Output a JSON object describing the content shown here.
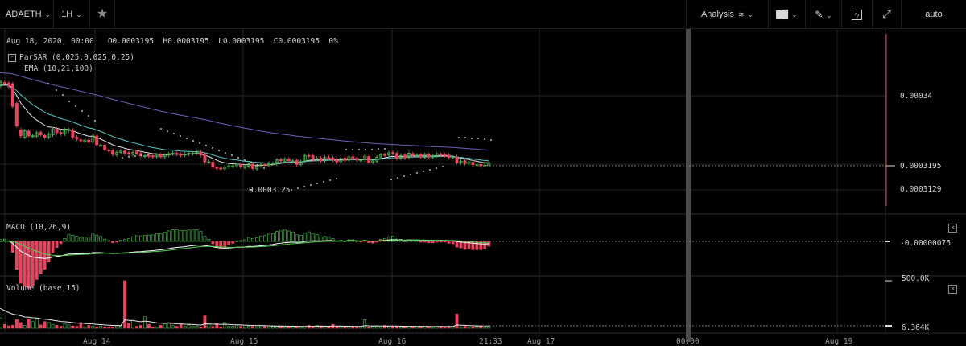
{
  "toolbar": {
    "symbol": "ADAETH",
    "interval": "1H",
    "analysis_label": "Analysis",
    "auto_label": "auto",
    "icons": [
      "star-icon",
      "indicators-icon",
      "bar-style-icon",
      "draw-pencil-icon",
      "chart-settings-icon",
      "fullscreen-icon"
    ]
  },
  "legend": {
    "ohlc": "Aug 18, 2020, 00:00   O0.0003195  H0.0003195  L0.0003195  C0.0003195  0%",
    "parsar": "ParSAR (0.025,0.025,0.25)",
    "ema": "EMA (10,21,100)",
    "macd": "MACD (10,26,9)",
    "volume": "Volume (base,15)"
  },
  "price_axis": {
    "labels": [
      {
        "text": "0.00034",
        "value": 0.00034
      },
      {
        "text": "0.0003195",
        "value": 0.0003195
      },
      {
        "text": "0.0003129",
        "value": 0.0003129
      }
    ],
    "low_annotation": "0.0003125"
  },
  "macd_axis": {
    "label": "-0.00000076"
  },
  "volume_axis": {
    "labels": [
      "500.0K",
      "6.364K"
    ]
  },
  "time_axis": {
    "labels": [
      "Aug 14",
      "Aug 15",
      "Aug 16",
      "21:33",
      "Aug 17",
      "00:00",
      "Aug 19"
    ]
  },
  "colors": {
    "bull": "#4caf50",
    "bear": "#e5455f",
    "ema_fast": "#e8e8e8",
    "ema_mid": "#5fc4c4",
    "ema_slow": "#6e5fb8",
    "macd": "#ffffff",
    "signal": "#55d055"
  },
  "chart_data": {
    "type": "candlestick",
    "price_open": [
      0.0003428,
      0.000343,
      0.000344,
      0.0003438,
      0.0003436,
      0.0003377,
      0.0003298,
      0.0003276,
      0.0003294,
      0.0003279,
      0.0003279,
      0.000329,
      0.0003281,
      0.0003275,
      0.0003283,
      0.00033,
      0.000329,
      0.0003286,
      0.0003296,
      0.0003297,
      0.0003276,
      0.0003268,
      0.0003263,
      0.0003267,
      0.0003262,
      0.0003279,
      0.0003252,
      0.0003252,
      0.0003237,
      0.0003236,
      0.0003223,
      0.000323,
      0.0003234,
      0.0003229,
      0.0003224,
      0.0003232,
      0.0003227,
      0.0003219,
      0.0003221,
      0.000322,
      0.0003217,
      0.0003223,
      0.0003217,
      0.0003222,
      0.0003226,
      0.0003227,
      0.0003224,
      0.0003222,
      0.0003225,
      0.0003227,
      0.0003228,
      0.0003232,
      0.0003222,
      0.0003202,
      0.0003201,
      0.0003185,
      0.0003183,
      0.0003181,
      0.0003186,
      0.0003189,
      0.000319,
      0.0003194,
      0.0003185,
      0.0003189,
      0.0003195,
      0.0003181,
      0.000319,
      0.0003194,
      0.0003192,
      0.0003197,
      0.0003196,
      0.0003208,
      0.0003204,
      0.000321,
      0.0003205,
      0.0003206,
      0.0003194,
      0.0003205,
      0.0003221,
      0.000322,
      0.000321,
      0.0003213,
      0.0003205,
      0.0003215,
      0.0003214,
      0.0003207,
      0.0003202,
      0.0003213,
      0.0003207,
      0.0003217,
      0.0003213,
      0.0003207,
      0.0003208,
      0.0003218,
      0.0003201,
      0.0003204,
      0.0003217,
      0.0003224,
      0.0003222,
      0.0003229,
      0.0003227,
      0.0003213,
      0.0003222,
      0.0003215,
      0.0003226,
      0.0003222,
      0.0003223,
      0.0003215,
      0.0003224,
      0.0003216,
      0.000322,
      0.0003225,
      0.0003223,
      0.0003222,
      0.0003215,
      0.0003217,
      0.00032,
      0.0003205,
      0.0003197,
      0.0003201,
      0.0003193,
      0.0003194,
      0.0003191,
      0.0003192,
      0.0003199,
      0.00032
    ],
    "price_close": [
      0.000343,
      0.0003441,
      0.0003437,
      0.0003428,
      0.0003368,
      0.000331,
      0.000328,
      0.0003295,
      0.000328,
      0.000328,
      0.0003289,
      0.0003283,
      0.0003275,
      0.0003285,
      0.0003301,
      0.000329,
      0.0003286,
      0.0003297,
      0.0003298,
      0.0003276,
      0.000327,
      0.0003265,
      0.0003267,
      0.0003261,
      0.000328,
      0.0003253,
      0.0003252,
      0.0003238,
      0.0003235,
      0.0003224,
      0.000323,
      0.0003234,
      0.0003228,
      0.0003225,
      0.000323,
      0.0003227,
      0.000322,
      0.000322,
      0.0003219,
      0.0003217,
      0.0003222,
      0.0003217,
      0.0003222,
      0.0003226,
      0.0003228,
      0.0003225,
      0.0003221,
      0.0003225,
      0.0003228,
      0.0003228,
      0.0003231,
      0.0003222,
      0.0003202,
      0.0003202,
      0.0003186,
      0.0003183,
      0.000318,
      0.0003186,
      0.000319,
      0.000319,
      0.0003195,
      0.0003186,
      0.0003188,
      0.0003196,
      0.0003182,
      0.0003189,
      0.0003193,
      0.0003192,
      0.0003197,
      0.0003197,
      0.0003208,
      0.0003205,
      0.000321,
      0.0003205,
      0.0003205,
      0.0003194,
      0.0003203,
      0.000322,
      0.0003219,
      0.0003209,
      0.0003212,
      0.0003205,
      0.0003215,
      0.0003214,
      0.0003207,
      0.0003202,
      0.0003212,
      0.0003207,
      0.0003217,
      0.0003213,
      0.0003207,
      0.0003207,
      0.0003219,
      0.00032,
      0.0003205,
      0.0003216,
      0.0003223,
      0.0003221,
      0.0003229,
      0.0003228,
      0.0003212,
      0.0003221,
      0.0003214,
      0.0003227,
      0.0003221,
      0.0003222,
      0.0003216,
      0.0003224,
      0.0003216,
      0.0003219,
      0.0003225,
      0.0003222,
      0.0003221,
      0.0003215,
      0.0003216,
      0.0003199,
      0.0003204,
      0.0003197,
      0.0003202,
      0.0003193,
      0.0003193,
      0.000319,
      0.0003192,
      0.00032,
      0.0003195,
      0.0003195
    ],
    "volume": [
      220000,
      110000,
      40000,
      25000,
      30000,
      90000,
      60000,
      30000,
      100000,
      70000,
      100000,
      35000,
      70000,
      60000,
      40000,
      30000,
      20000,
      50000,
      35000,
      25000,
      20000,
      60000,
      15000,
      30000,
      20000,
      15000,
      20000,
      15000,
      10000,
      15000,
      25000,
      20000,
      500000,
      50000,
      80000,
      20000,
      30000,
      120000,
      40000,
      10000,
      15000,
      30000,
      45000,
      60000,
      30000,
      20000,
      40000,
      20000,
      35000,
      20000,
      20000,
      10000,
      130000,
      45000,
      20000,
      50000,
      15000,
      60000,
      20000,
      20000,
      35000,
      20000,
      15000,
      20000,
      20000,
      15000,
      30000,
      20000,
      15000,
      20000,
      20000,
      20000,
      10000,
      20000,
      15000,
      20000,
      10000,
      15000,
      30000,
      20000,
      30000,
      25000,
      20000,
      15000,
      40000,
      20000,
      20000,
      10000,
      20000,
      15000,
      10000,
      20000,
      90000,
      10000,
      20000,
      20000,
      15000,
      30000,
      20000,
      20000,
      20000,
      10000,
      15000,
      20000,
      20000,
      15000,
      20000,
      20000,
      15000,
      10000,
      20000,
      20000,
      15000,
      20000,
      15000,
      150000,
      15000,
      20000,
      10000,
      15000,
      20000,
      20000,
      15000,
      20000,
      6364,
      6364
    ]
  }
}
